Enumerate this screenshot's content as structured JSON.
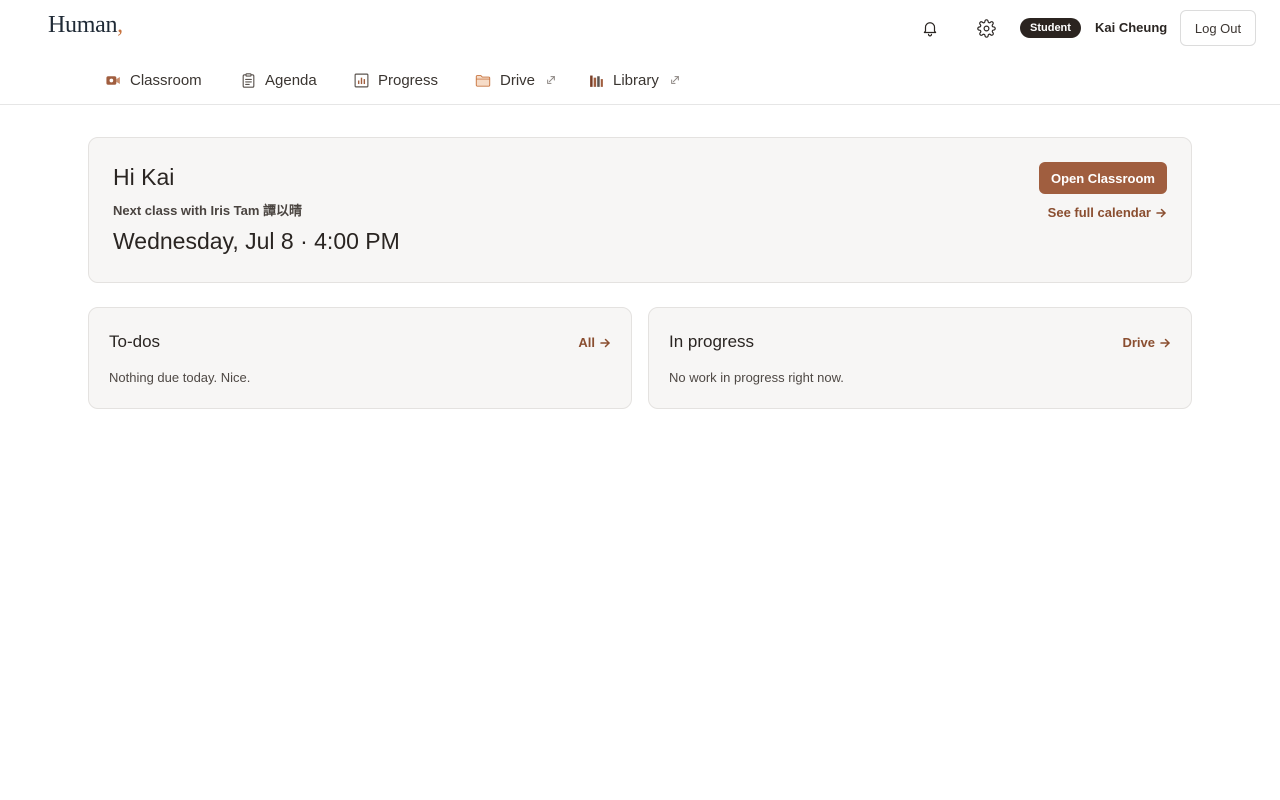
{
  "brand": {
    "name": "Human",
    "mark": ","
  },
  "header": {
    "role_badge": "Student",
    "user_name": "Kai Cheung",
    "logout_label": "Log Out"
  },
  "nav": {
    "items": [
      {
        "label": "Classroom",
        "icon": "video-camera-icon",
        "external": false
      },
      {
        "label": "Agenda",
        "icon": "clipboard-icon",
        "external": false
      },
      {
        "label": "Progress",
        "icon": "bar-chart-icon",
        "external": false
      },
      {
        "label": "Drive",
        "icon": "folder-icon",
        "external": true
      },
      {
        "label": "Library",
        "icon": "books-icon",
        "external": true
      }
    ]
  },
  "hero": {
    "greeting": "Hi Kai",
    "subtitle": "Next class with Iris Tam 譚以晴",
    "datetime": "Wednesday, Jul 8 · 4:00 PM",
    "primary_button": "Open Classroom",
    "calendar_link": "See full calendar"
  },
  "todos": {
    "title": "To-dos",
    "link": "All",
    "empty_text": "Nothing due today. Nice."
  },
  "in_progress": {
    "title": "In progress",
    "link": "Drive",
    "empty_text": "No work in progress right now."
  },
  "colors": {
    "accent": "#a05e3f",
    "link": "#8a4e30",
    "badge_bg": "#2b2420",
    "card_bg": "#f7f6f5"
  }
}
